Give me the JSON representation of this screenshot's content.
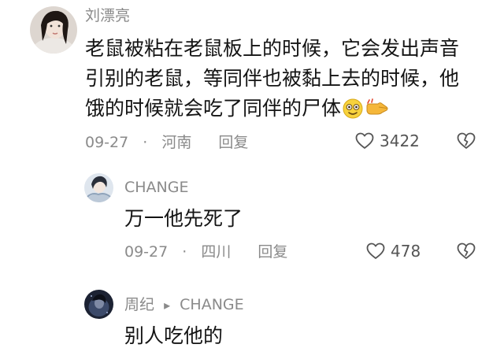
{
  "comments": [
    {
      "author": "刘漂亮",
      "text": "老鼠被粘在老鼠板上的时候，它会发出声音引别的老鼠，等同伴也被黏上去的时候，他饿的时候就会吃了同伴的尸体",
      "emojis": [
        "smiling-face-icon",
        "pointing-hand-icon"
      ],
      "date": "09-27",
      "separator": "·",
      "location": "河南",
      "reply_label": "回复",
      "like_count": "3422"
    },
    {
      "author": "CHANGE",
      "text": "万一他先死了",
      "date": "09-27",
      "separator": "·",
      "location": "四川",
      "reply_label": "回复",
      "like_count": "478"
    },
    {
      "author": "周纪",
      "reply_arrow": "▸",
      "reply_to": "CHANGE",
      "text": "别人吃他的"
    }
  ],
  "colors": {
    "text": "#141414",
    "meta": "#8a8a8a",
    "icon": "#555555"
  }
}
